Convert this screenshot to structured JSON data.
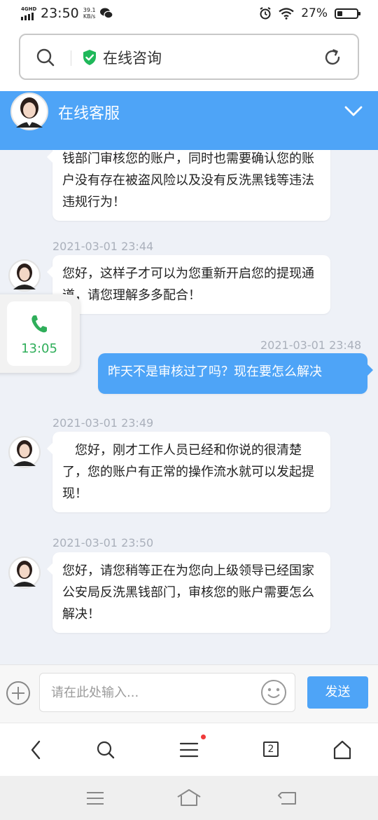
{
  "status_bar": {
    "network": "4GHD",
    "time": "23:50",
    "speed_value": "39.1",
    "speed_unit": "KB/s",
    "battery_percent": "27%",
    "battery_level": 0.27
  },
  "browser": {
    "url_title": "在线咨询",
    "tab_count": "2"
  },
  "chat_header": {
    "title": "在线客服"
  },
  "messages": [
    {
      "side": "left",
      "timestamp": "",
      "text": "钱部门审核您的账户，同时也需要确认您的账户没有存在被盗风险以及没有反洗黑钱等违法违规行为！"
    },
    {
      "side": "left",
      "timestamp": "2021-03-01 23:44",
      "text": "您好，这样子才可以为您重新开启您的提现通道，请您理解多多配合！"
    },
    {
      "side": "right",
      "timestamp": "2021-03-01 23:48",
      "text": "昨天不是审核过了吗？现在要怎么解决"
    },
    {
      "side": "left",
      "timestamp": "2021-03-01 23:49",
      "text": "您好，刚才工作人员已经和你说的很清楚了，您的账户有正常的操作流水就可以发起提现！"
    },
    {
      "side": "left",
      "timestamp": "2021-03-01 23:50",
      "text": "您好，请您稍等正在为您向上级领导已经国家公安局反洗黑钱部门，审核您的账户需要怎么解决！"
    }
  ],
  "call_widget": {
    "duration": "13:05"
  },
  "input": {
    "placeholder": "请在此处输入...",
    "send_label": "发送"
  },
  "colors": {
    "accent": "#4ea4f7",
    "chat_bg": "#eef1f7",
    "call_green": "#2fae5a",
    "shield_green": "#1fb85a"
  }
}
